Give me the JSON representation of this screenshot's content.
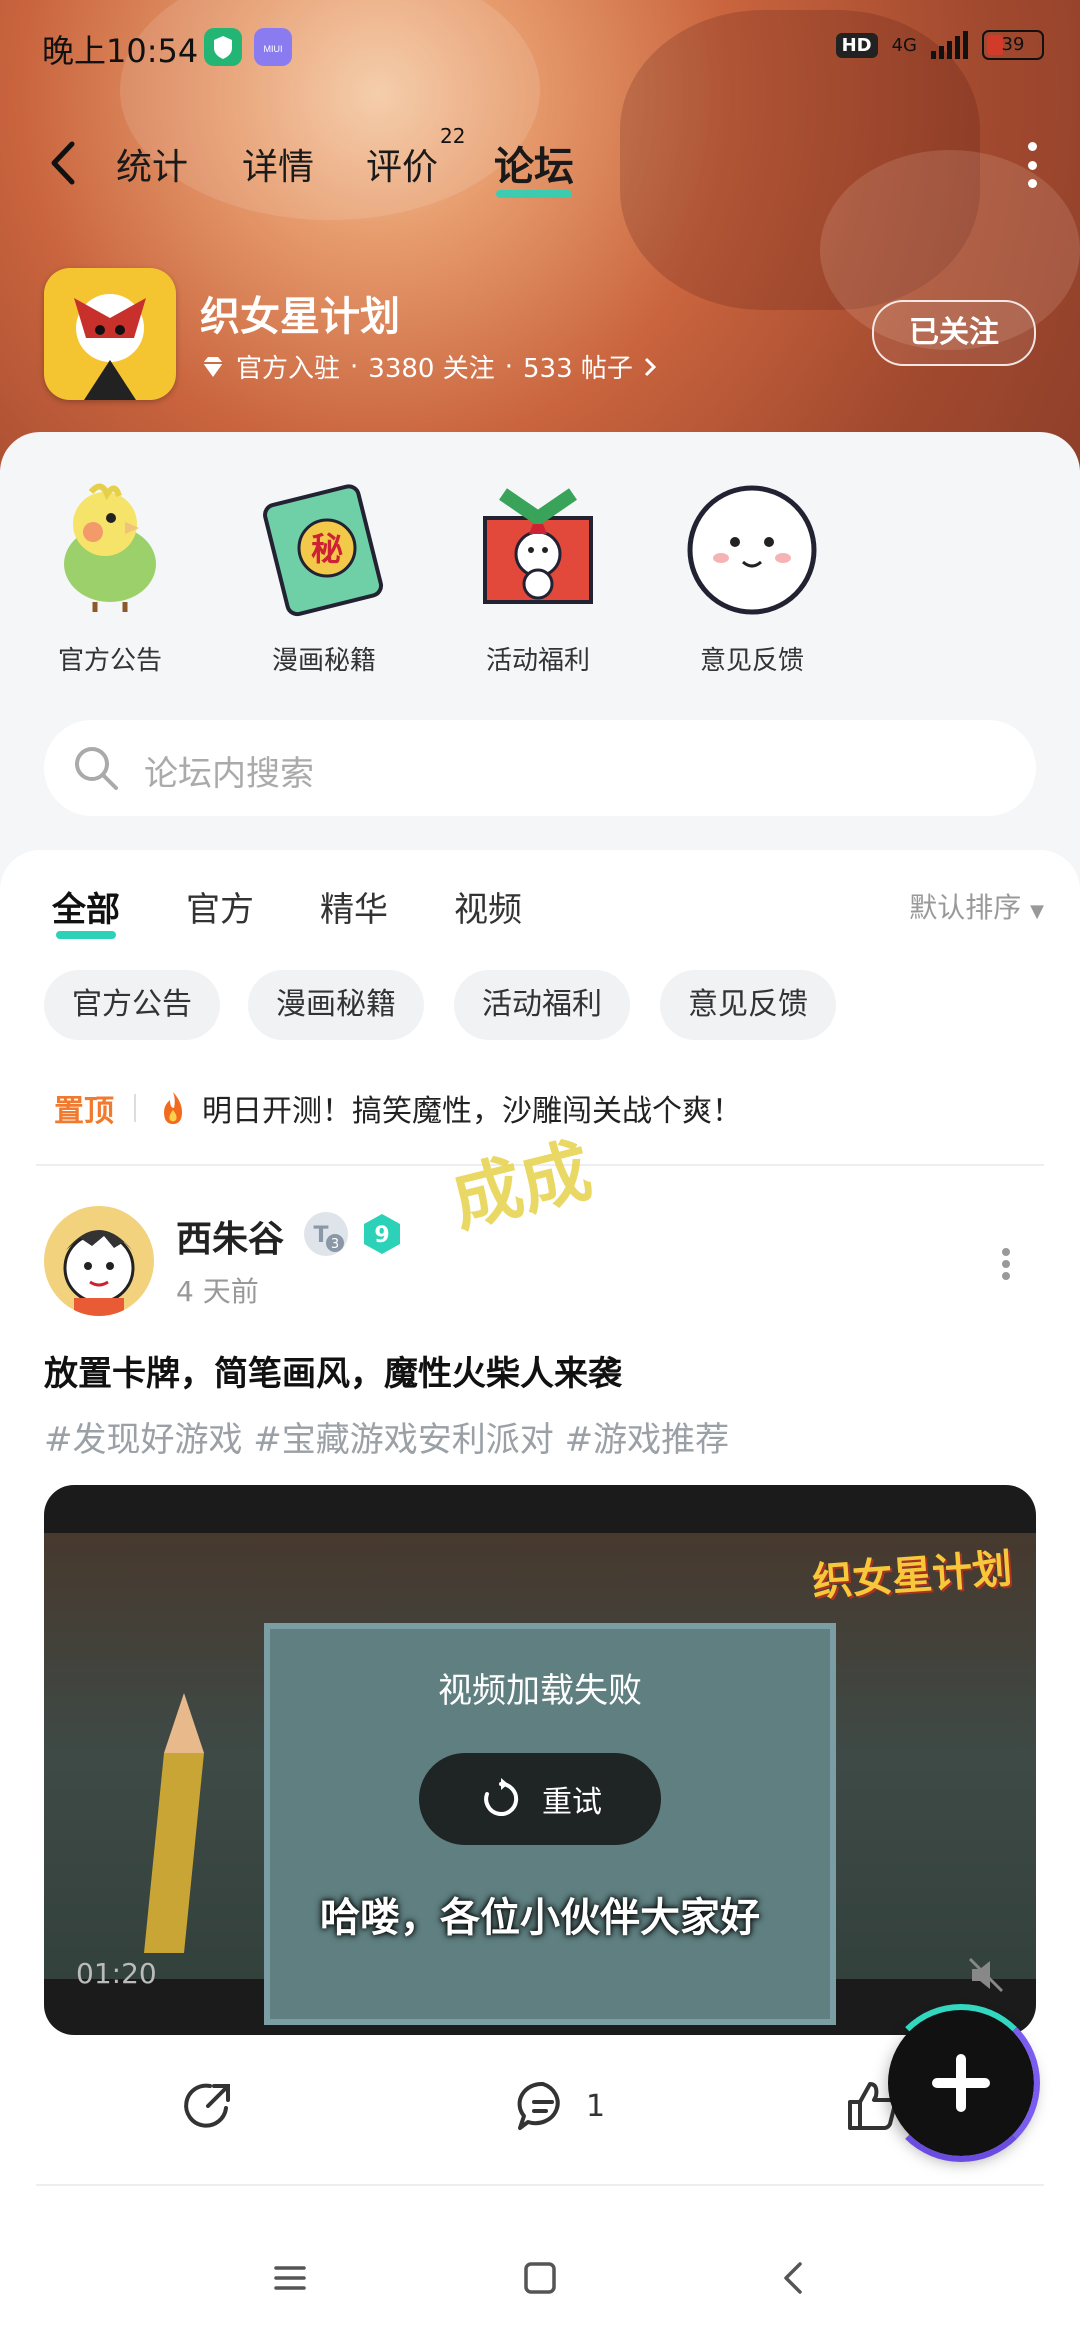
{
  "status_bar": {
    "time": "晚上10:54",
    "hd": "HD",
    "network": "4G",
    "battery": "39"
  },
  "nav": {
    "tabs": [
      {
        "label": "统计"
      },
      {
        "label": "详情"
      },
      {
        "label": "评价",
        "count": "22"
      },
      {
        "label": "论坛",
        "active": true
      }
    ]
  },
  "game": {
    "name": "织女星计划",
    "official": "官方入驻",
    "followers": "3380 关注",
    "posts": "533 帖子",
    "follow_button": "已关注"
  },
  "categories": [
    {
      "label": "官方公告",
      "icon": "parrot-icon"
    },
    {
      "label": "漫画秘籍",
      "icon": "secret-book-icon"
    },
    {
      "label": "活动福利",
      "icon": "gift-box-icon"
    },
    {
      "label": "意见反馈",
      "icon": "feedback-face-icon"
    }
  ],
  "search": {
    "placeholder": "论坛内搜索"
  },
  "feed": {
    "tabs": [
      "全部",
      "官方",
      "精华",
      "视频"
    ],
    "sort": "默认排序",
    "chips": [
      "官方公告",
      "漫画秘籍",
      "活动福利",
      "意见反馈"
    ],
    "pinned": {
      "tag": "置顶",
      "text": "明日开测！搞笑魔性，沙雕闯关战个爽！"
    },
    "watermark": "成成"
  },
  "post": {
    "author": "西朱谷",
    "level_badge": "3",
    "rank_badge": "9",
    "time": "4 天前",
    "title": "放置卡牌，简笔画风，魔性火柴人来袭",
    "tags": "#发现好游戏 #宝藏游戏安利派对 #游戏推荐",
    "video": {
      "error": "视频加载失败",
      "retry": "重试",
      "subtitle": "哈喽，各位小伙伴大家好",
      "duration": "01:20",
      "logo": "织女星计划"
    },
    "comments": "1"
  },
  "colors": {
    "accent": "#2bd2b8",
    "pin": "#f27a2f",
    "tag": "#9aa0a6"
  }
}
